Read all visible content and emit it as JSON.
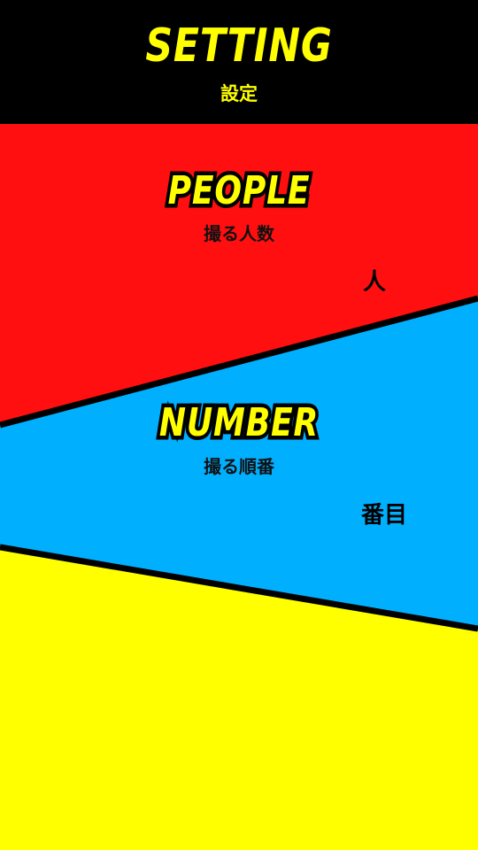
{
  "header": {
    "title": "SETTING",
    "subtitle": "設定"
  },
  "people": {
    "title": "PEOPLE",
    "subtitle": "撮る人数",
    "value": "",
    "unit": "人"
  },
  "number": {
    "title": "NUMBER",
    "subtitle": "撮る順番",
    "value": "",
    "unit": "番目"
  },
  "colors": {
    "header_bg": "#000000",
    "header_text": "#FFFF00",
    "people_panel": "#FF0F0F",
    "number_panel": "#00B0FF",
    "bottom_panel": "#FFFF00",
    "divider": "#000000"
  }
}
